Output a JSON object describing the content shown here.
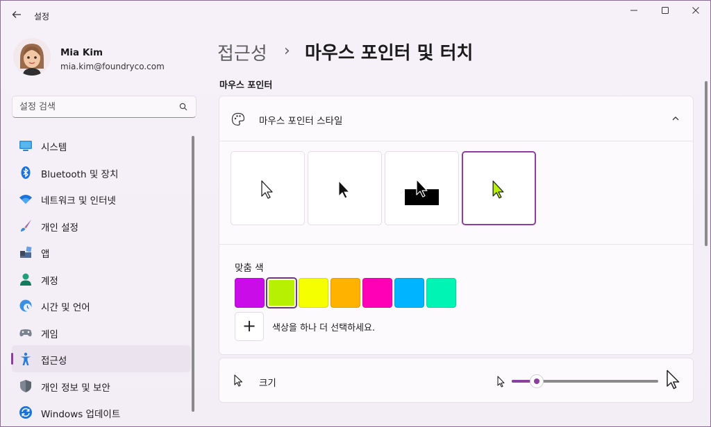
{
  "app": {
    "title": "설정"
  },
  "window_controls": {
    "minimize": "—",
    "maximize": "☐",
    "close": "✕"
  },
  "user": {
    "name": "Mia Kim",
    "email": "mia.kim@foundryco.com"
  },
  "search": {
    "placeholder": "설정 검색"
  },
  "nav": {
    "items": [
      {
        "label": "시스템",
        "icon": "system-icon"
      },
      {
        "label": "Bluetooth 및 장치",
        "icon": "bluetooth-icon"
      },
      {
        "label": "네트워크 및 인터넷",
        "icon": "wifi-icon"
      },
      {
        "label": "개인 설정",
        "icon": "brush-icon"
      },
      {
        "label": "앱",
        "icon": "apps-icon"
      },
      {
        "label": "계정",
        "icon": "account-icon"
      },
      {
        "label": "시간 및 언어",
        "icon": "time-language-icon"
      },
      {
        "label": "게임",
        "icon": "gamepad-icon"
      },
      {
        "label": "접근성",
        "icon": "accessibility-icon",
        "active": true
      },
      {
        "label": "개인 정보 및 보안",
        "icon": "shield-icon"
      },
      {
        "label": "Windows 업데이트",
        "icon": "update-icon"
      }
    ]
  },
  "breadcrumb": {
    "parent": "접근성",
    "separator": "›",
    "current": "마우스 포인터 및 터치"
  },
  "section": {
    "title": "마우스 포인터"
  },
  "pointer_style": {
    "label": "마우스 포인터 스타일",
    "options": [
      "white",
      "black",
      "inverted",
      "custom"
    ],
    "selected_index": 3
  },
  "custom_color": {
    "label": "맞춤 색",
    "swatches": [
      "#c90ce8",
      "#b7f000",
      "#f6ff00",
      "#ffb300",
      "#ff00b6",
      "#00b4ff",
      "#00f5b4"
    ],
    "selected_index": 1,
    "add_label": "+",
    "add_text": "색상을 하나 더 선택하세요."
  },
  "size": {
    "label": "크기",
    "value_fraction": 0.17
  },
  "colors": {
    "accent": "#8d3d9e",
    "pointer_custom": "#b7f000"
  }
}
